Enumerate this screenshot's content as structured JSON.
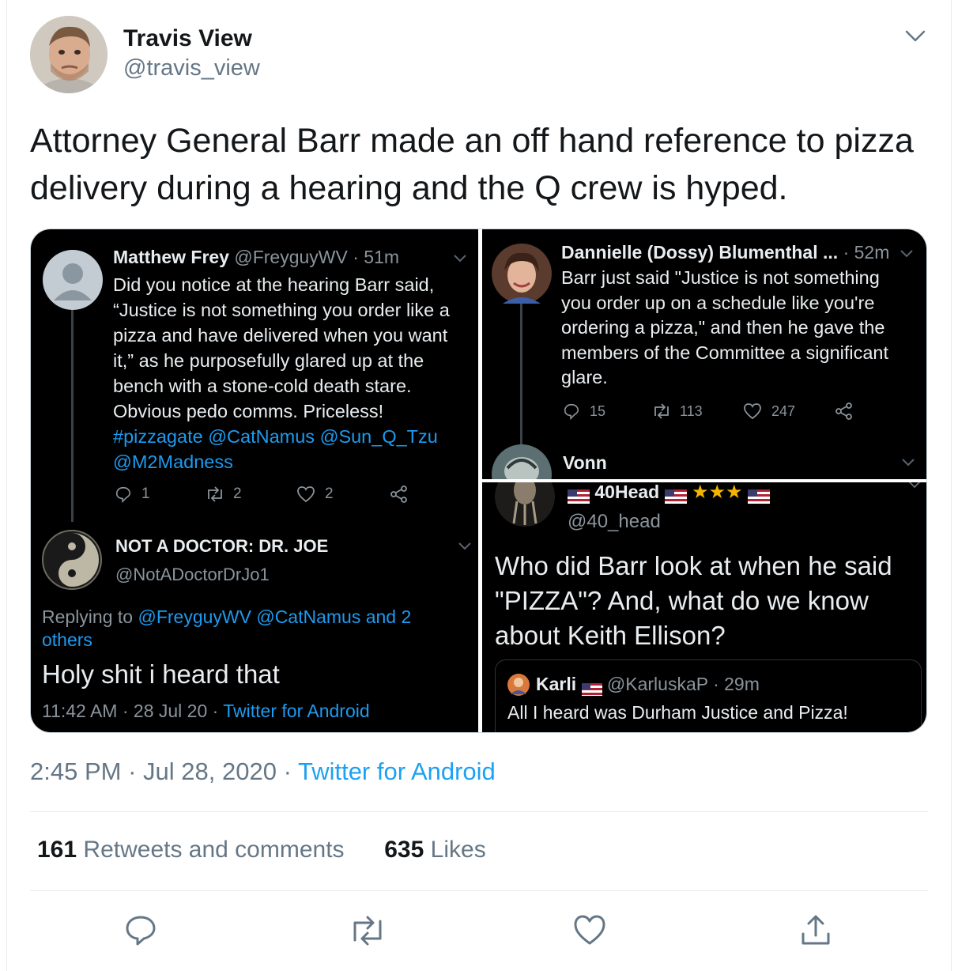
{
  "tweet": {
    "author_name": "Travis View",
    "author_handle": "@travis_view",
    "text": "Attorney General Barr made an off hand reference to pizza delivery during a hearing and the Q crew is hyped.",
    "time": "2:45 PM",
    "date": "Jul 28, 2020",
    "separator": "·",
    "source": "Twitter for Android",
    "retweets_count": "161",
    "retweets_label": "Retweets and comments",
    "likes_count": "635",
    "likes_label": "Likes"
  },
  "media": {
    "left": {
      "tweet1": {
        "name": "Matthew Frey",
        "handle": "@FreyguyWV · 51m",
        "lines": [
          "Did you notice at the hearing Barr said,",
          "“Justice is not something you order like a",
          "pizza and have delivered when you want",
          "it,” as he purposefully glared up at the",
          "bench with a stone-cold death stare.",
          "Obvious pedo comms. Priceless!"
        ],
        "tags1": "#pizzagate @CatNamus  @Sun_Q_Tzu",
        "tags2": "@M2Madness",
        "replies": "1",
        "retweets": "2",
        "likes": "2"
      },
      "tweet2": {
        "name": "NOT A DOCTOR: DR. JOE",
        "handle": "@NotADoctorDrJo1",
        "replying_prefix": "Replying to ",
        "replying_links": "@FreyguyWV @CatNamus and 2",
        "replying_line2": "others",
        "text": "Holy shit i heard that",
        "meta": "11:42 AM · 28 Jul 20 · ",
        "source": "Twitter for Android"
      }
    },
    "top_right": {
      "name": "Dannielle (Dossy) Blumenthal ...",
      "time": "· 52m",
      "lines": [
        "Barr just said \"Justice is not something",
        "you order up on a schedule like you're",
        "ordering a pizza,\" and then he gave the",
        "members of the Committee a significant",
        "glare."
      ],
      "replies": "15",
      "retweets": "113",
      "likes": "247",
      "next_name": "Vonn"
    },
    "bottom_right": {
      "name": "40Head",
      "handle": "@40_head",
      "lines": [
        "Who did Barr look at when he said",
        "\"PIZZA\"? And, what do we know",
        "about Keith Ellison?"
      ],
      "quote_name": "Karli",
      "quote_handle": "@KarluskaP · 29m",
      "quote_text": "All I heard was Durham Justice and Pizza!"
    }
  },
  "icons": [
    "chevron-down-icon",
    "reply-icon",
    "retweet-icon",
    "like-icon",
    "share-icon"
  ],
  "colors": {
    "link": "#1da1f2",
    "muted": "#657786",
    "text": "#14171a",
    "dark_bg": "#000000"
  }
}
